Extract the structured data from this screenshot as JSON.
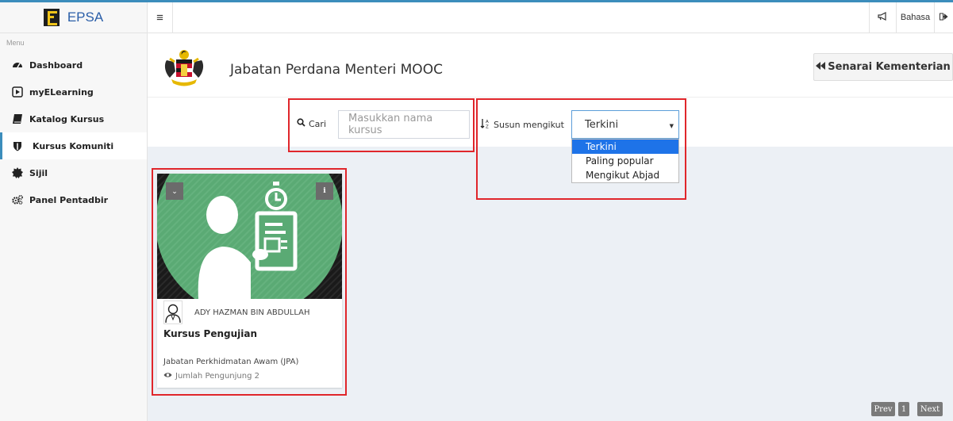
{
  "brand": {
    "name": "EPSA"
  },
  "topbar": {
    "language_label": "Bahasa"
  },
  "sidebar": {
    "header": "Menu",
    "items": [
      {
        "label": "Dashboard",
        "icon": "tachometer-icon"
      },
      {
        "label": "myELearning",
        "icon": "play-square-icon"
      },
      {
        "label": "Katalog Kursus",
        "icon": "book-icon"
      },
      {
        "label": "Kursus Komuniti",
        "icon": "shield-icon",
        "active": true
      },
      {
        "label": "Sijil",
        "icon": "certificate-icon"
      },
      {
        "label": "Panel Pentadbir",
        "icon": "cogs-icon"
      }
    ]
  },
  "header": {
    "title": "Jabatan Perdana Menteri MOOC",
    "senarai_button": "Senarai Kementerian"
  },
  "filters": {
    "search_label": "Cari",
    "search_placeholder": "Masukkan nama kursus",
    "sort_label": "Susun mengikut",
    "sort_selected": "Terkini",
    "sort_options": [
      "Terkini",
      "Paling popular",
      "Mengikut Abjad"
    ]
  },
  "course_card": {
    "author": "ADY HAZMAN BIN ABDULLAH",
    "title": "Kursus Pengujian",
    "agency": "Jabatan Perkhidmatan Awam (JPA)",
    "visitors": "Jumlah Pengunjung 2"
  },
  "pagination": {
    "prev": "Prev",
    "page": "1",
    "next": "Next"
  },
  "colors": {
    "accent": "#3c8dbc",
    "highlight_box": "#e0262b",
    "card_green": "#5aaa74",
    "dropdown_selected": "#1e73e8"
  }
}
